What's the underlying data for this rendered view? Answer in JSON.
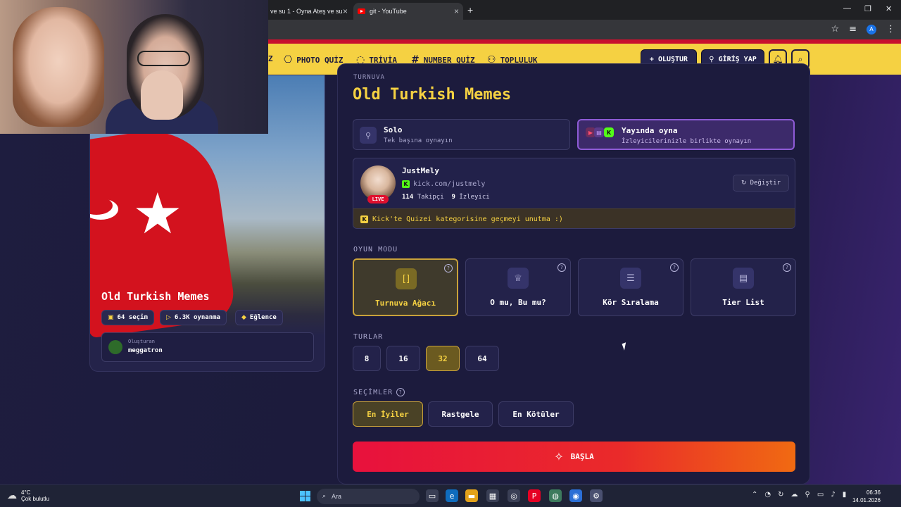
{
  "browser": {
    "tabs": [
      {
        "title": "ve su 1 - Oyna Ateş ve su"
      },
      {
        "title": "git - YouTube"
      }
    ],
    "new_tab": "+",
    "window_controls": {
      "minimize": "—",
      "maximize": "❐",
      "close": "✕"
    },
    "profile_initial": "A"
  },
  "header": {
    "nav": [
      {
        "label": "Z",
        "icon": "quiz-icon"
      },
      {
        "label": "PHOTO QUİZ",
        "icon": "camera-icon"
      },
      {
        "label": "TRİVİA",
        "icon": "chat-icon"
      },
      {
        "label": "NUMBER QUİZ",
        "icon": "hash-icon"
      },
      {
        "label": "TOPLULUK",
        "icon": "users-icon"
      }
    ],
    "create_label": "OLUŞTUR",
    "login_label": "GİRİŞ YAP"
  },
  "left_card": {
    "title": "Old Turkish Memes",
    "chips": [
      {
        "label": "64 seçim",
        "icon": "images-icon"
      },
      {
        "label": "6.3K oynanma",
        "icon": "play-icon"
      },
      {
        "label": "Eğlence",
        "icon": "category-icon"
      }
    ],
    "creator_label": "Oluşturan",
    "creator_name": "meggatron"
  },
  "main": {
    "kicker": "TURNUVA",
    "title": "Old Turkish Memes",
    "modes": [
      {
        "title": "Solo",
        "subtitle": "Tek başına oynayın",
        "active": false
      },
      {
        "title": "Yayında oyna",
        "subtitle": "İzleyicilerinizle birlikte oynayın",
        "active": true
      }
    ],
    "streamer": {
      "name": "JustMely",
      "url": "kick.com/justmely",
      "followers": "114",
      "followers_label": "Takipçi",
      "viewers": "9",
      "viewers_label": "İzleyici",
      "live_badge": "LIVE",
      "change_label": "Değiştir",
      "note": "Kick'te Quizei kategorisine geçmeyi unutma :)"
    },
    "game_mode_label": "OYUN MODU",
    "game_modes": [
      {
        "label": "Turnuva Ağacı",
        "icon": "bracket-icon",
        "active": true
      },
      {
        "label": "O mu, Bu mu?",
        "icon": "crown-icon",
        "active": false
      },
      {
        "label": "Kör Sıralama",
        "icon": "list-icon",
        "active": false
      },
      {
        "label": "Tier List",
        "icon": "tier-icon",
        "active": false
      }
    ],
    "rounds_label": "TURLAR",
    "rounds": [
      {
        "label": "8",
        "active": false
      },
      {
        "label": "16",
        "active": false
      },
      {
        "label": "32",
        "active": true
      },
      {
        "label": "64",
        "active": false
      }
    ],
    "selections_label": "SEÇİMLER",
    "selections": [
      {
        "label": "En İyiler",
        "active": true
      },
      {
        "label": "Rastgele",
        "active": false
      },
      {
        "label": "En Kötüler",
        "active": false
      }
    ],
    "start_label": "BAŞLA"
  },
  "taskbar": {
    "weather_temp": "4°C",
    "weather_desc": "Çok bulutlu",
    "search_placeholder": "Ara",
    "time": "06:36",
    "date": "14.01.2026"
  },
  "colors": {
    "accent_yellow": "#f5d142",
    "stripe_red": "#c8102e",
    "start_gradient_start": "#e8113d",
    "start_gradient_end": "#f06a12",
    "active_purple": "#8e5bd6"
  }
}
